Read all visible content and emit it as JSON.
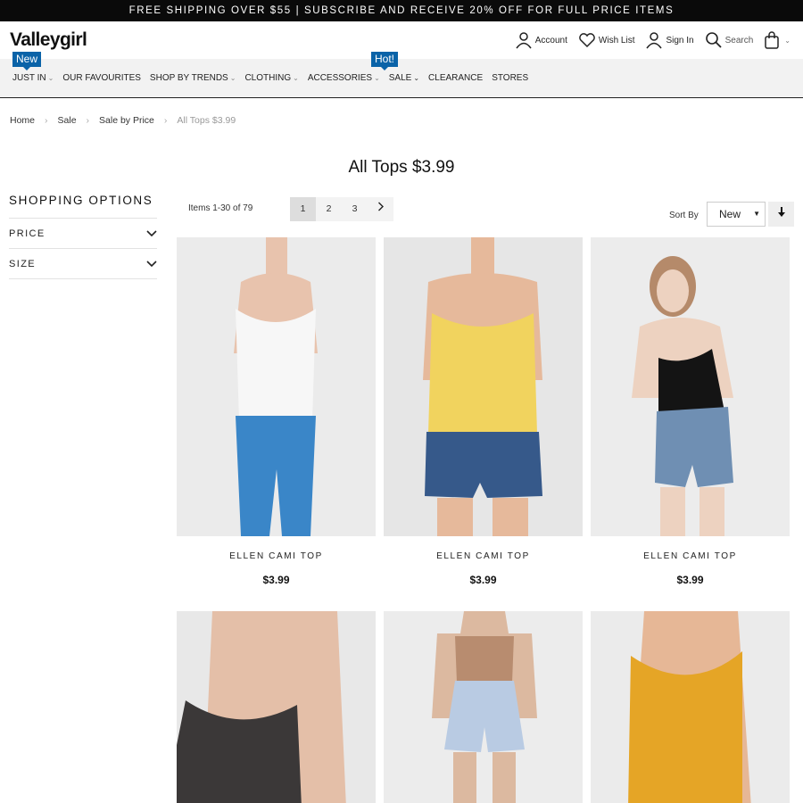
{
  "promo": "FREE SHIPPING OVER $55 | SUBSCRIBE AND RECEIVE 20% OFF FOR FULL PRICE ITEMS",
  "brand": "Valleygirl",
  "header": {
    "account": "Account",
    "wishlist": "Wish List",
    "signin": "Sign In",
    "search": "Search"
  },
  "nav": {
    "new_tag": "New",
    "hot_tag": "Hot!",
    "items": [
      "JUST IN",
      "OUR FAVOURITES",
      "SHOP BY TRENDS",
      "CLOTHING",
      "ACCESSORIES",
      "SALE",
      "CLEARANCE",
      "STORES"
    ]
  },
  "breadcrumb": [
    "Home",
    "Sale",
    "Sale by Price",
    "All Tops $3.99"
  ],
  "title": "All Tops $3.99",
  "sidebar": {
    "heading": "SHOPPING OPTIONS",
    "filters": [
      "PRICE",
      "SIZE"
    ]
  },
  "toolbar": {
    "count": "Items 1-30 of 79",
    "pages": [
      "1",
      "2",
      "3"
    ],
    "sort_label": "Sort By",
    "sort_value": "New"
  },
  "products": [
    {
      "name": "ELLEN CAMI TOP",
      "price": "$3.99",
      "top_color": "#f7f7f7",
      "bottom_color": "#3a86c8"
    },
    {
      "name": "ELLEN CAMI TOP",
      "price": "$3.99",
      "top_color": "#f1d35e",
      "bottom_color": "#36598a"
    },
    {
      "name": "ELLEN CAMI TOP",
      "price": "$3.99",
      "top_color": "#141414",
      "bottom_color": "#6f8fb3"
    },
    {
      "name": "",
      "price": "",
      "top_color": "#3b3838",
      "bottom_color": ""
    },
    {
      "name": "",
      "price": "",
      "top_color": "#b88c6f",
      "bottom_color": "#b9cbe3"
    },
    {
      "name": "",
      "price": "",
      "top_color": "#e5a526",
      "bottom_color": ""
    }
  ]
}
